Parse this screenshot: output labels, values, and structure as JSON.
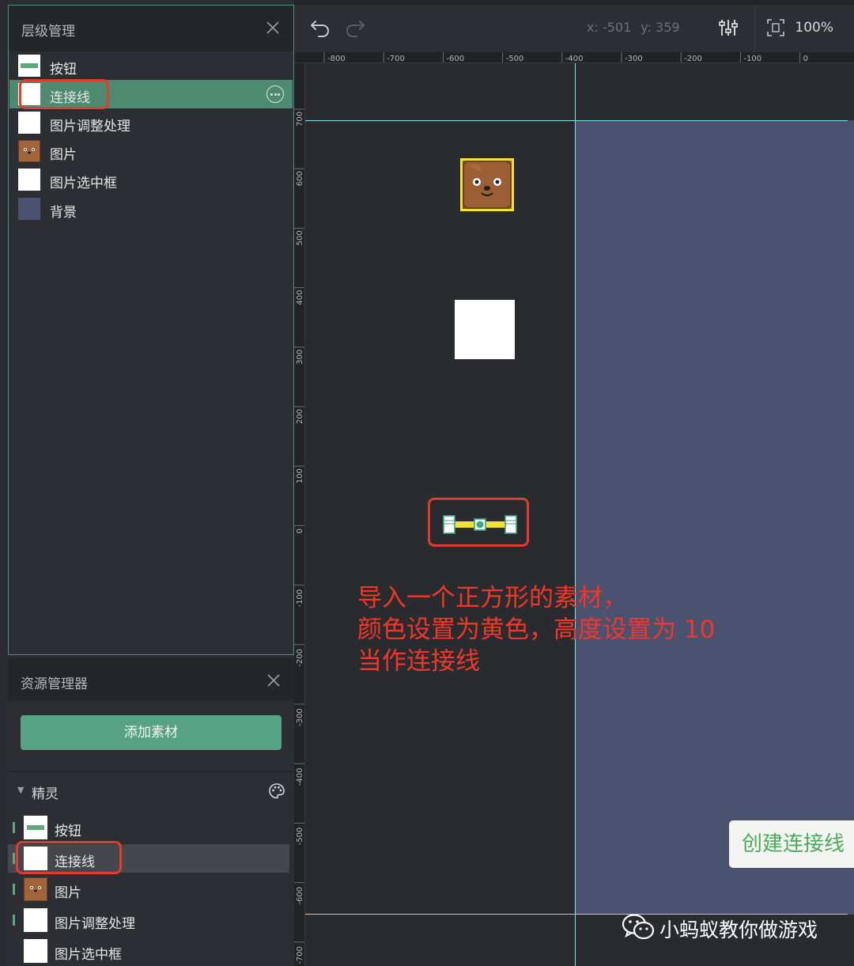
{
  "layer_panel": {
    "title": "层级管理",
    "items": [
      {
        "label": "按钮",
        "thumb": "button"
      },
      {
        "label": "连接线",
        "thumb": "white",
        "selected": true
      },
      {
        "label": "图片调整处理",
        "thumb": "white"
      },
      {
        "label": "图片",
        "thumb": "bear"
      },
      {
        "label": "图片选中框",
        "thumb": "white"
      },
      {
        "label": "背景",
        "thumb": "background"
      }
    ]
  },
  "asset_panel": {
    "title": "资源管理器",
    "add_button": "添加素材",
    "group": "精灵",
    "items": [
      {
        "label": "按钮",
        "thumb": "button"
      },
      {
        "label": "连接线",
        "thumb": "white",
        "highlighted": true
      },
      {
        "label": "图片",
        "thumb": "bear"
      },
      {
        "label": "图片调整处理",
        "thumb": "white"
      },
      {
        "label": "图片选中框",
        "thumb": "white"
      }
    ]
  },
  "toolbar": {
    "x": "x: -501",
    "y": "y: 359",
    "zoom": "100%"
  },
  "rulers": {
    "top": [
      "-800",
      "-700",
      "-600",
      "-500",
      "-400",
      "-300",
      "-200",
      "-100",
      "0"
    ],
    "left": [
      "700",
      "600",
      "500",
      "400",
      "300",
      "200",
      "100",
      "0",
      "-100",
      "-200",
      "-300",
      "-400",
      "-500",
      "-600",
      "-700"
    ]
  },
  "canvas": {
    "annotation": [
      "导入一个正方形的素材，",
      "颜色设置为黄色，高度设置为 10",
      "当作连接线"
    ],
    "create_button": "创建连接线"
  },
  "watermark": "小蚂蚁教你做游戏",
  "colors": {
    "accent": "#57a285",
    "selection": "#4d8a6f",
    "guide": "#7fe3ea",
    "highlight": "#e23b2f",
    "annotation": "#f2372a",
    "world_background": "#4a5270",
    "connector": "#f0e23a"
  }
}
